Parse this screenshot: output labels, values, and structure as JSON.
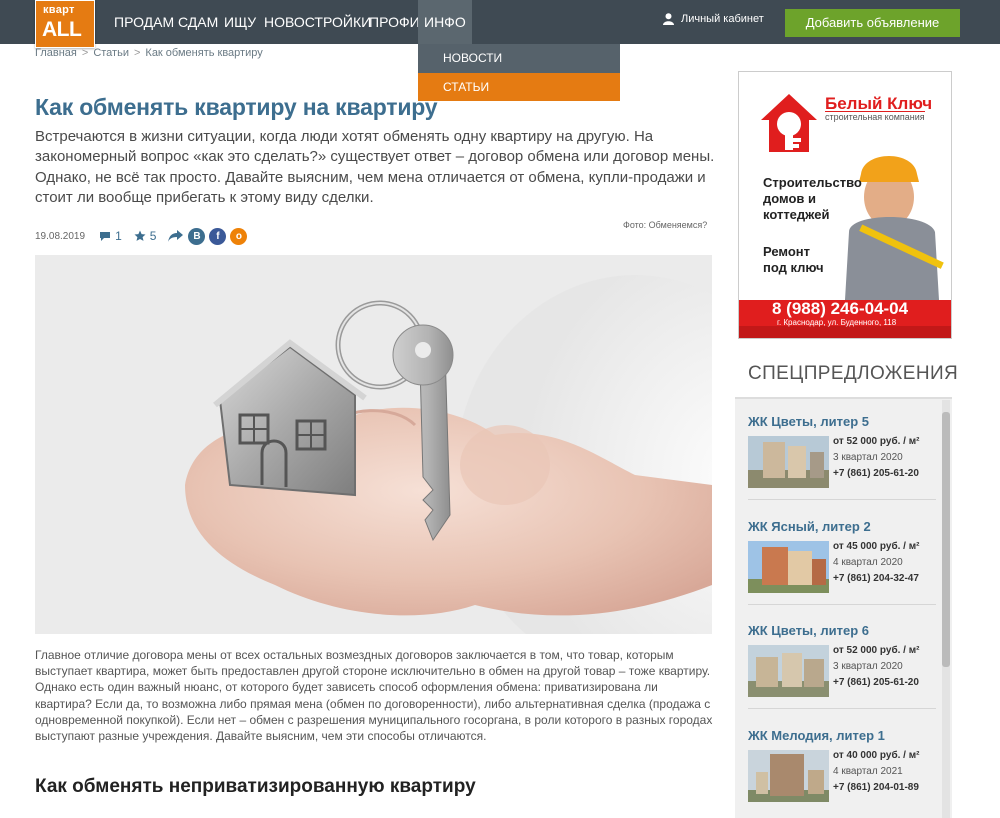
{
  "logo": {
    "line1": "кварт",
    "line2": "ALL"
  },
  "nav": [
    "ПРОДАМ",
    "СДАМ",
    "ИЩУ",
    "НОВОСТРОЙКИ",
    "ПРОФИ",
    "ИНФО"
  ],
  "cabinet": "Личный кабинет",
  "add_button": "Добавить объявление",
  "dropdown": {
    "news": "НОВОСТИ",
    "articles": "СТАТЬИ"
  },
  "breadcrumb": [
    "Главная",
    ">",
    "Статьи",
    ">",
    "Как обменять квартиру"
  ],
  "article": {
    "title": "Как обменять квартиру на квартиру",
    "lead": "Встречаются в жизни ситуации, когда люди хотят обменять одну квартиру на другую. На закономерный вопрос «как это сделать?» существует ответ – договор обмена или договор мены. Однако, не всё так просто. Давайте выясним, чем мена отличается от обмена, купли-продажи и стоит ли вообще прибегать к этому виду сделки.",
    "photo_caption": "Фото: Обменяемся?",
    "date": "19.08.2019",
    "comments": "1",
    "rating": "5",
    "body": "Главное отличие договора мены от всех остальных возмездных договоров заключается в том, что товар, которым выступает квартира, может быть предоставлен другой стороне исключительно в обмен на другой товар – тоже квартиру. Однако есть один важный нюанс, от которого будет зависеть способ оформления обмена: приватизирована ли квартира? Если да, то возможна либо прямая мена (обмен по договоренности), либо альтернативная сделка (продажа с одновременной покупкой). Если нет – обмен с разрешения муниципального госоргана, в роли которого в разных городах выступают разные учреждения. Давайте выясним, чем эти способы отличаются.",
    "h2": "Как обменять неприватизированную квартиру"
  },
  "ad": {
    "brand": "Белый Ключ",
    "sub": "строительная компания",
    "l1": "Строительство",
    "l2": "домов и",
    "l3": "коттеджей",
    "l4": "Ремонт",
    "l5": "под ключ",
    "phone": "8 (988) 246-04-04",
    "addr": "г. Краснодар, ул. Буденного, 118"
  },
  "specials": {
    "title": "СПЕЦПРЕДЛОЖЕНИЯ",
    "items": [
      {
        "name": "ЖК Цветы, литер 5",
        "price": "от 52 000 руб. / м²",
        "date": "3 квартал 2020",
        "phone": "+7 (861) 205-61-20"
      },
      {
        "name": "ЖК Ясный, литер 2",
        "price": "от 45 000 руб. / м²",
        "date": "4 квартал 2020",
        "phone": "+7 (861) 204-32-47"
      },
      {
        "name": "ЖК Цветы, литер 6",
        "price": "от 52 000 руб. / м²",
        "date": "3 квартал 2020",
        "phone": "+7 (861) 205-61-20"
      },
      {
        "name": "ЖК Мелодия, литер 1",
        "price": "от 40 000 руб. / м²",
        "date": "4 квартал 2021",
        "phone": "+7 (861) 204-01-89"
      }
    ]
  }
}
